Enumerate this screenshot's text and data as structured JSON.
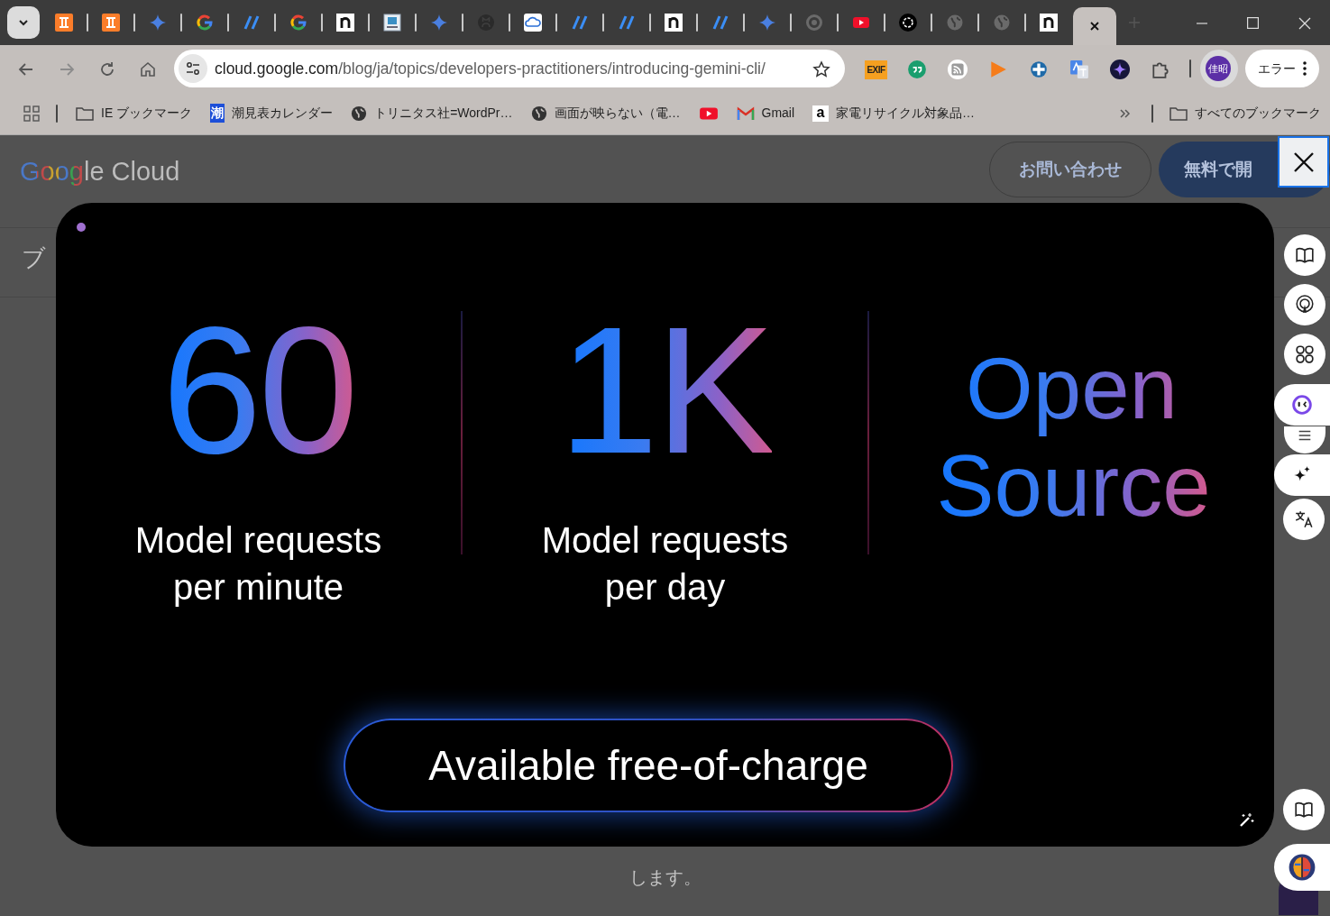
{
  "tab_strip": {
    "tabs": [
      {
        "kind": "xampp",
        "selected": false
      },
      {
        "kind": "xampp",
        "selected": false
      },
      {
        "kind": "gemini",
        "selected": false
      },
      {
        "kind": "google",
        "selected": false
      },
      {
        "kind": "slash",
        "selected": false
      },
      {
        "kind": "google",
        "selected": false
      },
      {
        "kind": "n-logo",
        "selected": false
      },
      {
        "kind": "image",
        "selected": false
      },
      {
        "kind": "gemini",
        "selected": false
      },
      {
        "kind": "github",
        "selected": false
      },
      {
        "kind": "cloud",
        "selected": false
      },
      {
        "kind": "slash",
        "selected": false
      },
      {
        "kind": "slash",
        "selected": false
      },
      {
        "kind": "n-logo",
        "selected": false
      },
      {
        "kind": "slash",
        "selected": false
      },
      {
        "kind": "gemini",
        "selected": false
      },
      {
        "kind": "chrome",
        "selected": false
      },
      {
        "kind": "youtube",
        "selected": false
      },
      {
        "kind": "openai",
        "selected": false
      },
      {
        "kind": "globe",
        "selected": false
      },
      {
        "kind": "globe",
        "selected": false
      },
      {
        "kind": "n-logo",
        "selected": false
      },
      {
        "kind": "blank",
        "selected": true
      }
    ]
  },
  "toolbar": {
    "address": {
      "host": "cloud.google.com",
      "path": "/blog/ja/topics/developers-practitioners/introducing-gemini-cli/"
    },
    "extensions": [
      {
        "kind": "exif",
        "label": "EXIF"
      },
      {
        "kind": "quote"
      },
      {
        "kind": "rss"
      },
      {
        "kind": "play"
      },
      {
        "kind": "cross"
      },
      {
        "kind": "translate"
      },
      {
        "kind": "sparkle"
      },
      {
        "kind": "puzzle"
      }
    ],
    "profile": "佳昭",
    "error_chip": "エラー"
  },
  "bookmarks": [
    {
      "kind": "folder",
      "label": "IE ブックマーク"
    },
    {
      "kind": "tide",
      "icon_text": "潮",
      "label": "潮見表カレンダー"
    },
    {
      "kind": "globe",
      "label": "トリニタス社=WordPr…"
    },
    {
      "kind": "globe",
      "label": "画面が映らない（電…"
    },
    {
      "kind": "youtube"
    },
    {
      "kind": "gmail",
      "label": "Gmail"
    },
    {
      "kind": "amazon",
      "icon_text": "a",
      "label": "家電リサイクル対象品…"
    }
  ],
  "all_bookmarks": "すべてのブックマーク",
  "page": {
    "logo": "Google Cloud",
    "contact_button": "お問い合わせ",
    "start_button": "無料で開",
    "breadcrumb": "ブ",
    "footer_text": "します。"
  },
  "modal": {
    "stats": [
      {
        "kind": "number",
        "value": "60",
        "label": "Model requests per minute"
      },
      {
        "kind": "number",
        "value": "1K",
        "label": "Model requests per day"
      },
      {
        "kind": "headline",
        "value": "Open Source"
      }
    ],
    "cta": "Available free-of-charge"
  },
  "side_tools": [
    {
      "kind": "book"
    },
    {
      "kind": "podcast"
    },
    {
      "kind": "apps"
    },
    {
      "kind": "face"
    },
    {
      "kind": "lines"
    },
    {
      "kind": "sparkle"
    },
    {
      "kind": "translate"
    },
    {
      "kind": "book"
    },
    {
      "kind": "brain"
    }
  ]
}
